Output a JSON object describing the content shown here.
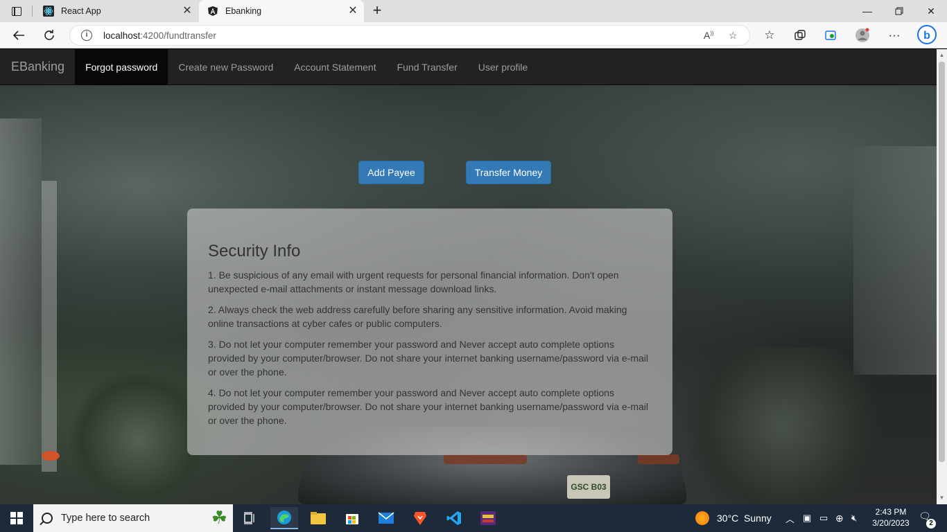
{
  "browser": {
    "tabs": [
      {
        "label": "React App",
        "icon": "react-icon"
      },
      {
        "label": "Ebanking",
        "icon": "angular-icon",
        "active": true
      }
    ],
    "url_host": "localhost",
    "url_path": ":4200/fundtransfer"
  },
  "navbar": {
    "brand": "EBanking",
    "items": [
      {
        "label": "Forgot password",
        "active": true
      },
      {
        "label": "Create new Password"
      },
      {
        "label": "Account Statement"
      },
      {
        "label": "Fund Transfer"
      },
      {
        "label": "User profile"
      }
    ]
  },
  "actions": {
    "add_payee": "Add Payee",
    "transfer_money": "Transfer Money"
  },
  "security": {
    "title": "Security Info",
    "items": [
      "1. Be suspicious of any email with urgent requests for personal financial information. Don't open unexpected e-mail attachments or instant message download links.",
      "2. Always check the web address carefully before sharing any sensitive information. Avoid making online transactions at cyber cafes or public computers.",
      "3. Do not let your computer remember your password and Never accept auto complete options provided by your computer/browser. Do not share your internet banking username/password via e-mail or over the phone.",
      "4. Do not let your computer remember your password and Never accept auto complete options provided by your computer/browser. Do not share your internet banking username/password via e-mail or over the phone."
    ]
  },
  "scene": {
    "plate_text": "GSC B03"
  },
  "taskbar": {
    "search_placeholder": "Type here to search",
    "weather": "30°C  Sunny",
    "time": "2:43 PM",
    "date": "3/20/2023",
    "notifications": "2"
  },
  "colors": {
    "primary_button": "#337ab7",
    "navbar_bg": "#222222",
    "navbar_active": "#080808"
  }
}
